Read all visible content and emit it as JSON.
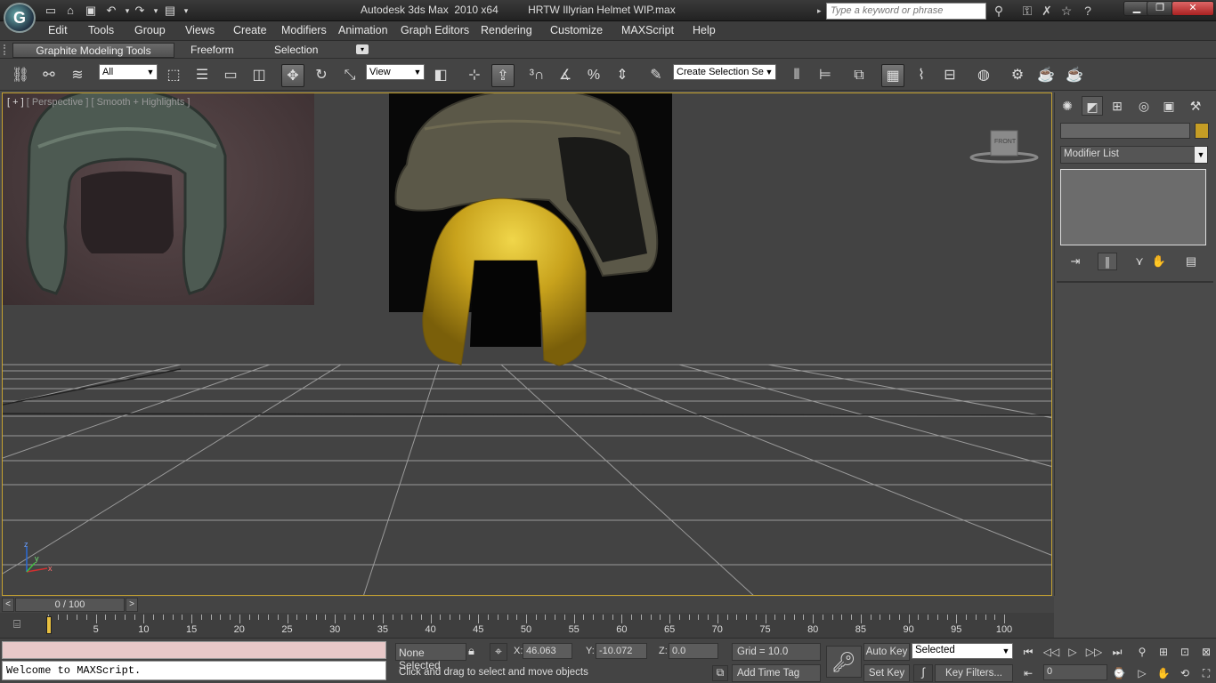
{
  "title_bar": {
    "app_title": "Autodesk 3ds Max  2010 x64",
    "file_name": "HRTW Illyrian Helmet WIP.max",
    "search_placeholder": "Type a keyword or phrase"
  },
  "menu": [
    "Edit",
    "Tools",
    "Group",
    "Views",
    "Create",
    "Modifiers",
    "Animation",
    "Graph Editors",
    "Rendering",
    "Customize",
    "MAXScript",
    "Help"
  ],
  "ribbon": {
    "tabs": [
      "Graphite Modeling Tools",
      "Freeform",
      "Selection"
    ]
  },
  "main_toolbar": {
    "selection_filter": "All",
    "reference_coord": "View",
    "named_selection": "Create Selection Se"
  },
  "viewport": {
    "label_plus": "[ + ]",
    "label_view": "[ Perspective ]",
    "label_shading": "[ Smooth + Highlights ]",
    "viewcube_face": "FRONT",
    "axis_x": "x",
    "axis_y": "y",
    "axis_z": "z"
  },
  "command_panel": {
    "modifier_list": "Modifier List"
  },
  "time_slider": {
    "frame_display": "0 / 100",
    "prev": "<",
    "next": ">"
  },
  "trackbar": {
    "ticks": [
      5,
      10,
      15,
      20,
      25,
      30,
      35,
      40,
      45,
      50,
      55,
      60,
      65,
      70,
      75,
      80,
      85,
      90,
      95,
      100
    ]
  },
  "status": {
    "maxscript_output": "Welcome to MAXScript.",
    "selection_status": "None Selected",
    "x_label": "X:",
    "x_value": "46.063",
    "y_label": "Y:",
    "y_value": "-10.072",
    "z_label": "Z:",
    "z_value": "0.0",
    "grid": "Grid = 10.0",
    "prompt": "Click and drag to select and move objects",
    "add_time_tag": "Add Time Tag",
    "auto_key": "Auto Key",
    "set_key": "Set Key",
    "key_mode": "Selected",
    "key_filters": "Key Filters...",
    "current_frame": "0"
  }
}
